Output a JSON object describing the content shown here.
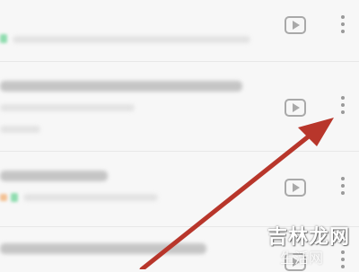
{
  "list": {
    "rows": [
      {
        "id": "row-1",
        "has_play": true,
        "has_more": true
      },
      {
        "id": "row-2",
        "has_play": true,
        "has_more": true
      },
      {
        "id": "row-3",
        "has_play": true,
        "has_more": true
      },
      {
        "id": "row-4",
        "has_play": true,
        "has_more": true
      }
    ]
  },
  "icons": {
    "play": "play-icon",
    "more": "more-vertical-icon",
    "annotation": "arrow-annotation"
  },
  "colors": {
    "annotation_arrow": "#b8362b",
    "icon_gray": "#a9a9a9",
    "background": "#f7f7f7"
  },
  "watermark": {
    "brand": "吉林龙网",
    "sub": "生活网"
  }
}
